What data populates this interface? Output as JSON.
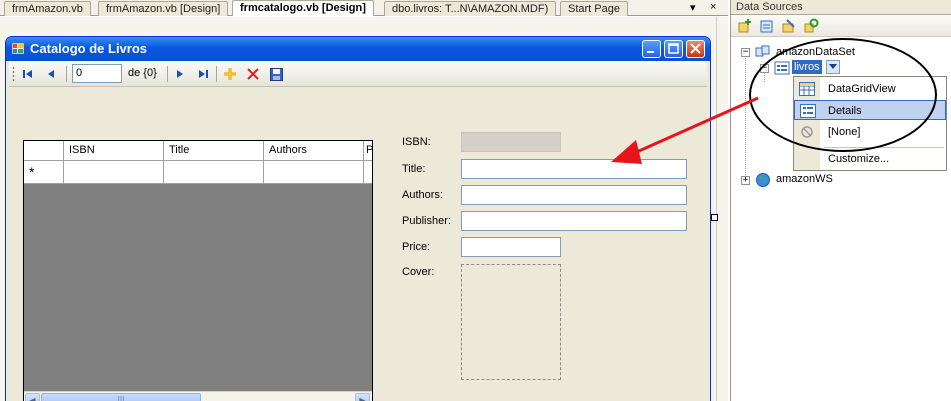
{
  "doc_tabs": [
    "frmAmazon.vb",
    "frmAmazon.vb [Design]",
    "frmcatalogo.vb [Design]",
    "dbo.livros: T...N\\AMAZON.MDF)",
    "Start Page"
  ],
  "tab_controls": {
    "dropdown": "▾",
    "close": "×"
  },
  "form": {
    "title": "Catalogo de Livros",
    "navigator": {
      "position": "0",
      "count": "de {0}"
    },
    "grid": {
      "columns": [
        "ISBN",
        "Title",
        "Authors",
        "P"
      ],
      "new_row_marker": "*",
      "scroll_thumb_grip": "III"
    },
    "details": {
      "isbn_label": "ISBN:",
      "title_label": "Title:",
      "authors_label": "Authors:",
      "publisher_label": "Publisher:",
      "price_label": "Price:",
      "cover_label": "Cover:"
    }
  },
  "data_sources": {
    "panel_title": "Data Sources",
    "tree": {
      "dataset": "amazonDataSet",
      "table": "livros",
      "web_service": "amazonWS"
    },
    "dropdown_menu": [
      "DataGridView",
      "Details",
      "[None]",
      "Customize..."
    ]
  },
  "colors": {
    "title_bar": "#0a58e0",
    "selection": "#316ac5",
    "annotation_arrow": "#e8141b",
    "grid_background": "#808080"
  }
}
